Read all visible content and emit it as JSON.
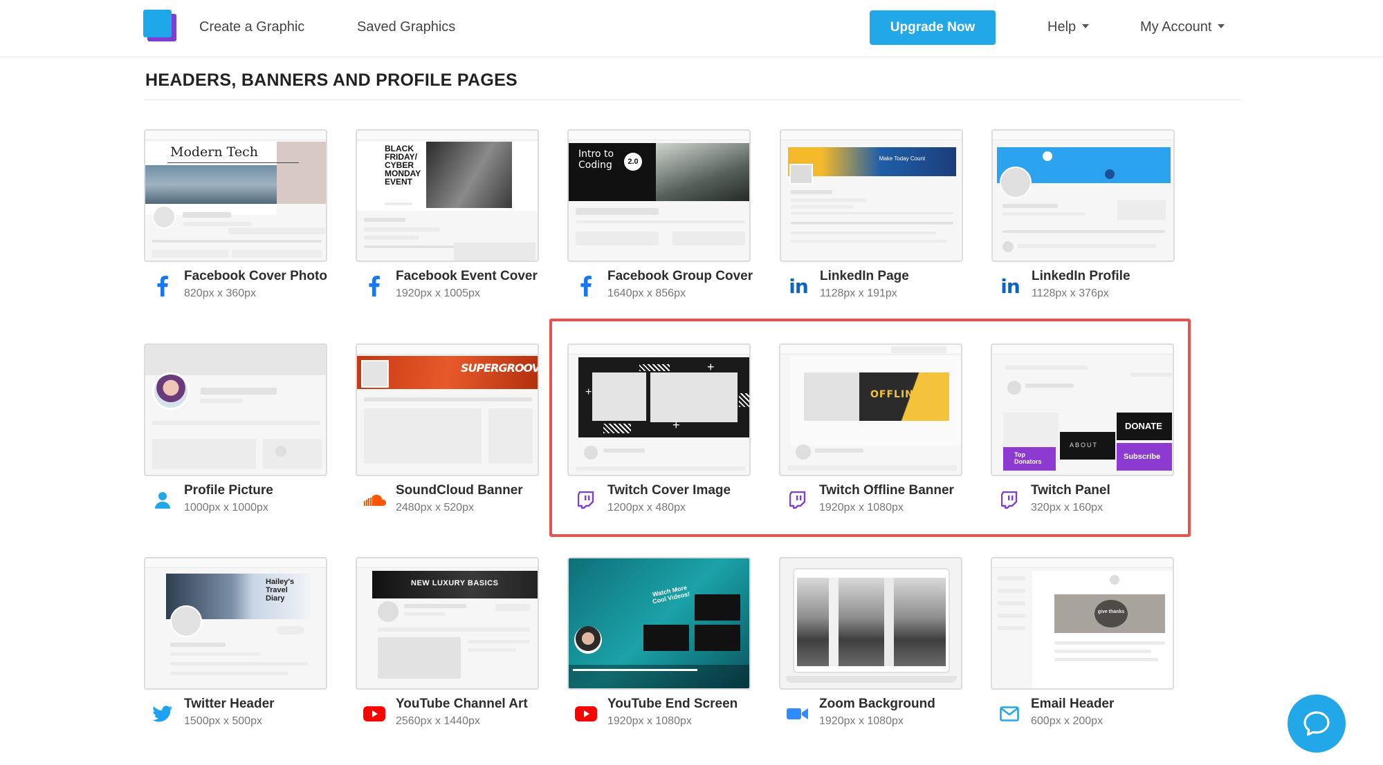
{
  "nav": {
    "create": "Create a Graphic",
    "saved": "Saved Graphics",
    "upgrade": "Upgrade Now",
    "help": "Help",
    "account": "My Account"
  },
  "section": {
    "title": "HEADERS, BANNERS AND PROFILE PAGES"
  },
  "cards": [
    {
      "title": "Facebook Cover Photo",
      "size": "820px x 360px",
      "icon": "facebook-icon",
      "thumb_text": "Modern Tech"
    },
    {
      "title": "Facebook Event Cover",
      "size": "1920px x 1005px",
      "icon": "facebook-icon",
      "thumb_text": "BLACK FRIDAY/ CYBER MONDAY EVENT"
    },
    {
      "title": "Facebook Group Cover",
      "size": "1640px x 856px",
      "icon": "facebook-icon",
      "thumb_text": "Intro to Coding",
      "thumb_badge": "2.0"
    },
    {
      "title": "LinkedIn Page",
      "size": "1128px x 191px",
      "icon": "linkedin-icon",
      "thumb_text": "Make Today Count"
    },
    {
      "title": "LinkedIn Profile",
      "size": "1128px x 376px",
      "icon": "linkedin-icon"
    },
    {
      "title": "Profile Picture",
      "size": "1000px x 1000px",
      "icon": "user-icon"
    },
    {
      "title": "SoundCloud Banner",
      "size": "2480px x 520px",
      "icon": "soundcloud-icon",
      "thumb_text": "SUPERGROOVE"
    },
    {
      "title": "Twitch Cover Image",
      "size": "1200px x 480px",
      "icon": "twitch-icon"
    },
    {
      "title": "Twitch Offline Banner",
      "size": "1920px x 1080px",
      "icon": "twitch-icon",
      "thumb_text": "OFFLINE"
    },
    {
      "title": "Twitch Panel",
      "size": "320px x 160px",
      "icon": "twitch-icon",
      "thumb_donate": "DONATE",
      "thumb_about": "ABOUT",
      "thumb_sub": "Subscribe",
      "thumb_top": "Top Donators"
    },
    {
      "title": "Twitter Header",
      "size": "1500px x 500px",
      "icon": "twitter-icon",
      "thumb_text": "Hailey's Travel Diary"
    },
    {
      "title": "YouTube Channel Art",
      "size": "2560px x 1440px",
      "icon": "youtube-icon",
      "thumb_text": "NEW LUXURY BASICS"
    },
    {
      "title": "YouTube End Screen",
      "size": "1920px x 1080px",
      "icon": "youtube-icon",
      "thumb_text": "Watch More Cool Videos!"
    },
    {
      "title": "Zoom Background",
      "size": "1920px x 1080px",
      "icon": "video-camera-icon"
    },
    {
      "title": "Email Header",
      "size": "600px x 200px",
      "icon": "envelope-icon",
      "thumb_text": "give thanks"
    }
  ],
  "colors": {
    "accent": "#22a7e8",
    "highlight": "#e9514f",
    "facebook": "#1877f2",
    "linkedin": "#0a66c2",
    "twitch": "#7d3fd1",
    "youtube": "#ff0000",
    "soundcloud": "#ff5500"
  }
}
